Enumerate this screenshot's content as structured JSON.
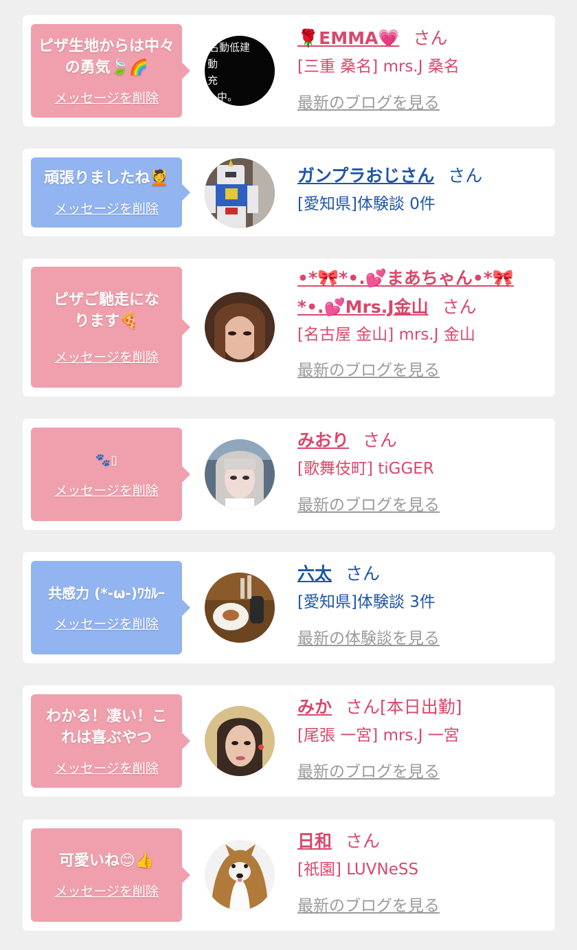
{
  "colors": {
    "pink_bubble": "#f0a0ad",
    "blue_bubble": "#92b4f0",
    "pink_text": "#d9476a",
    "blue_text": "#1d55a8",
    "link_gray": "#9a9a9a",
    "background": "#efefef"
  },
  "delete_label": "メッセージを削除",
  "cards": [
    {
      "bubble_color": "pink",
      "message": "ピザ生地からは中々の勇気🍃🌈",
      "name": "🌹EMMA💗",
      "honorific": "さん",
      "shop": "[三重 桑名] mrs.J 桑名",
      "link": "最新のブログを見る",
      "avatar_icon": "blackboard-text-avatar"
    },
    {
      "bubble_color": "blue",
      "message": "頑張りましたね💆",
      "name": "ガンプラおじさん",
      "honorific": "さん",
      "shop": "[愛知県]体験談 0件",
      "link": "",
      "avatar_icon": "robot-model-avatar"
    },
    {
      "bubble_color": "pink",
      "message": "ピザご馳走になります🍕",
      "name": "•*🎀*•.💕まあちゃん•*🎀*•.💕Mrs.J金山",
      "honorific": "さん",
      "shop": "[名古屋 金山] mrs.J 金山",
      "link": "最新のブログを見る",
      "avatar_icon": "woman-avatar"
    },
    {
      "bubble_color": "pink",
      "message": "🐾▯",
      "name": "みおり",
      "honorific": "さん",
      "shop": "[歌舞伎町] tiGGER",
      "link": "最新のブログを見る",
      "avatar_icon": "girl-avatar"
    },
    {
      "bubble_color": "blue",
      "message": "共感力 (*-ω-)ﾜｶﾙｰ",
      "name": "六太",
      "honorific": "さん",
      "shop": "[愛知県]体験談 3件",
      "link": "最新の体験談を見る",
      "avatar_icon": "food-plate-avatar"
    },
    {
      "bubble_color": "pink",
      "message": "わかる！凄い！これは喜ぶやつ",
      "name": "みか",
      "honorific": "さん[本日出勤]",
      "shop": "[尾張 一宮] mrs.J 一宮",
      "link": "最新のブログを見る",
      "avatar_icon": "woman-avatar"
    },
    {
      "bubble_color": "pink",
      "message": "可愛いね😊👍",
      "name": "日和",
      "honorific": "さん",
      "shop": "[祇園] LUVNeSS",
      "link": "最新のブログを見る",
      "avatar_icon": "dog-avatar"
    }
  ]
}
